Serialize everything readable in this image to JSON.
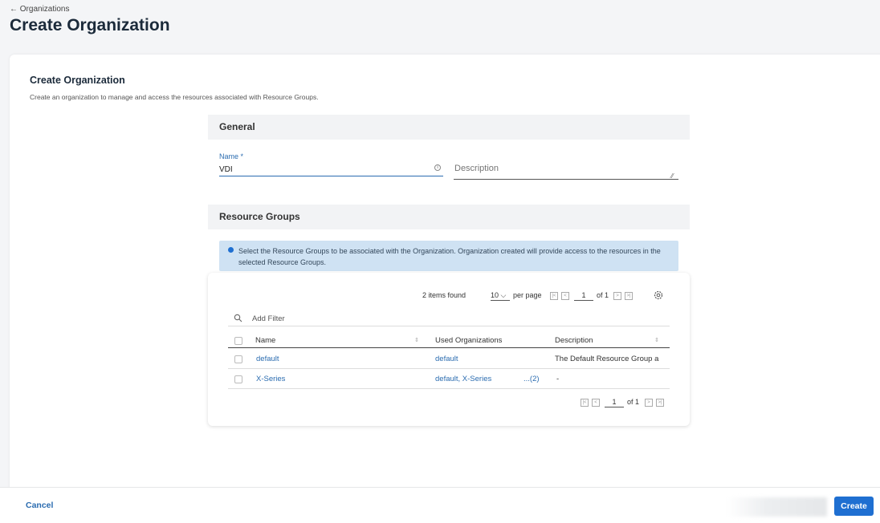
{
  "header": {
    "back_link": "← Organizations",
    "title": "Create Organization"
  },
  "form": {
    "card_title": "Create Organization",
    "card_subtitle": "Create an organization to manage and access the resources associated with Resource Groups.",
    "general_section": "General",
    "name_label": "Name *",
    "name_value": "VDI",
    "description_placeholder": "Description",
    "resource_groups_section": "Resource Groups",
    "info_message": "Select the Resource Groups to be associated with the Organization. Organization created will provide access to the resources in the selected Resource Groups."
  },
  "table": {
    "items_found": "2 items found",
    "per_page_value": "10 ⌵",
    "per_page_label": "per page",
    "page_current": "1",
    "page_of": "of 1",
    "filter_placeholder": "Add Filter",
    "columns": [
      "Name",
      "Used Organizations",
      "Description"
    ],
    "rows": [
      {
        "name": "default",
        "used_orgs": "default",
        "used_more": "",
        "description": "The Default Resource Group a"
      },
      {
        "name": "X-Series",
        "used_orgs": "default, X-Series",
        "used_more": "...(2)",
        "description": "-"
      }
    ],
    "bottom_page_current": "1",
    "bottom_page_of": "of 1"
  },
  "footer": {
    "cancel_label": "Cancel",
    "create_label": "Create"
  },
  "colors": {
    "accent": "#1f6fd1",
    "link": "#2b6cb0",
    "info_bg": "#cfe2f3"
  }
}
